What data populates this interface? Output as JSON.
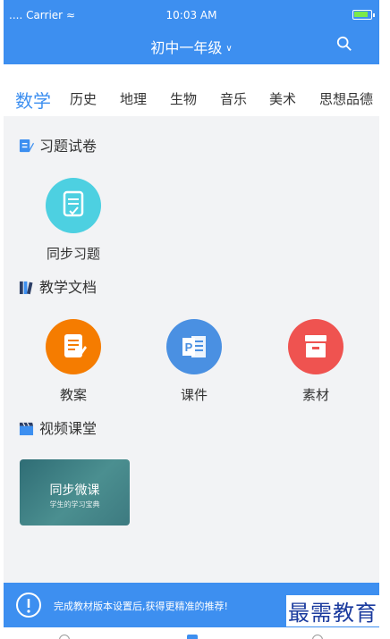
{
  "status": {
    "carrier": "Carrier",
    "time": "10:03 AM"
  },
  "header": {
    "title": "初中一年级"
  },
  "tabs": [
    "数学",
    "历史",
    "地理",
    "生物",
    "音乐",
    "美术",
    "思想品德"
  ],
  "sections": {
    "exercises": {
      "title": "习题试卷",
      "items": [
        {
          "label": "同步习题",
          "icon": "checklist-icon",
          "color": "#4dd0e1"
        }
      ]
    },
    "docs": {
      "title": "教学文档",
      "items": [
        {
          "label": "教案",
          "icon": "notes-icon",
          "color": "#f57c00"
        },
        {
          "label": "课件",
          "icon": "ppt-icon",
          "color": "#4a90e2"
        },
        {
          "label": "素材",
          "icon": "archive-icon",
          "color": "#ef5350"
        }
      ]
    },
    "video": {
      "title": "视频课堂",
      "card": {
        "title": "同步微课",
        "subtitle": "学生的学习宝典"
      }
    }
  },
  "notice": {
    "text": "完成教材版本设置后,获得更精准的推荐!",
    "brand": "最需教育"
  },
  "colors": {
    "primary": "#3d8ff0"
  }
}
